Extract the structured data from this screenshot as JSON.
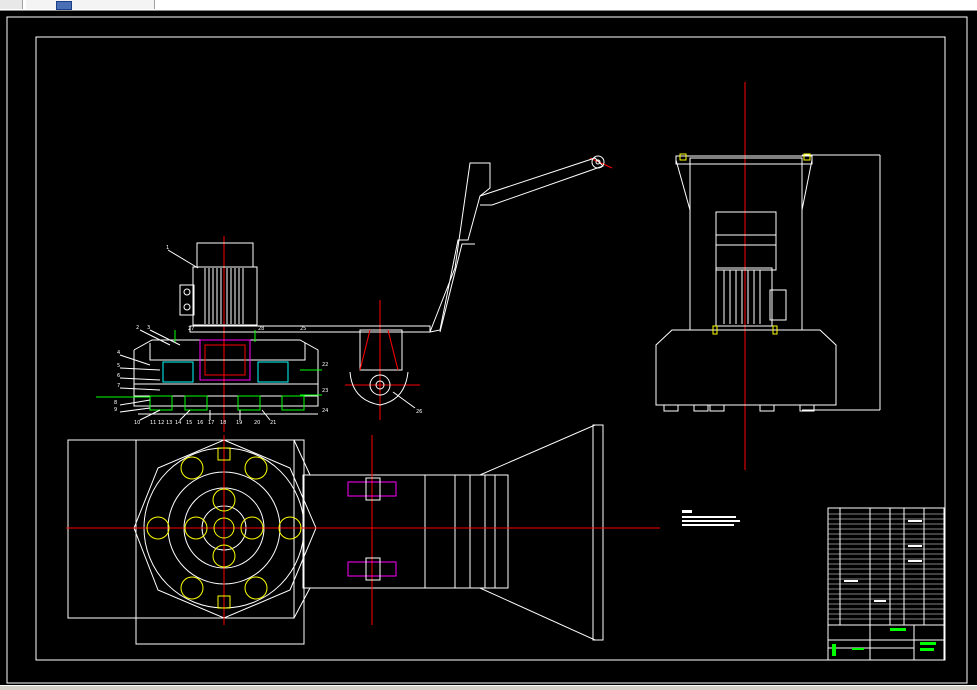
{
  "app": {
    "toolbar_thumb": "page-thumbnail-icon"
  },
  "drawing": {
    "background": "#000000",
    "line_color": "#ffffff",
    "center_line_color": "#ff0000",
    "part_color": "#ffff00",
    "hatch_color": "#00ff00",
    "accent_color": "#ff00ff",
    "balloon_numbers": [
      "1",
      "2",
      "3",
      "4",
      "5",
      "6",
      "7",
      "8",
      "9",
      "10",
      "11",
      "12",
      "13",
      "14",
      "15",
      "16",
      "17",
      "18",
      "19",
      "20",
      "21",
      "22",
      "23",
      "24",
      "25",
      "26",
      "27",
      "28"
    ]
  }
}
